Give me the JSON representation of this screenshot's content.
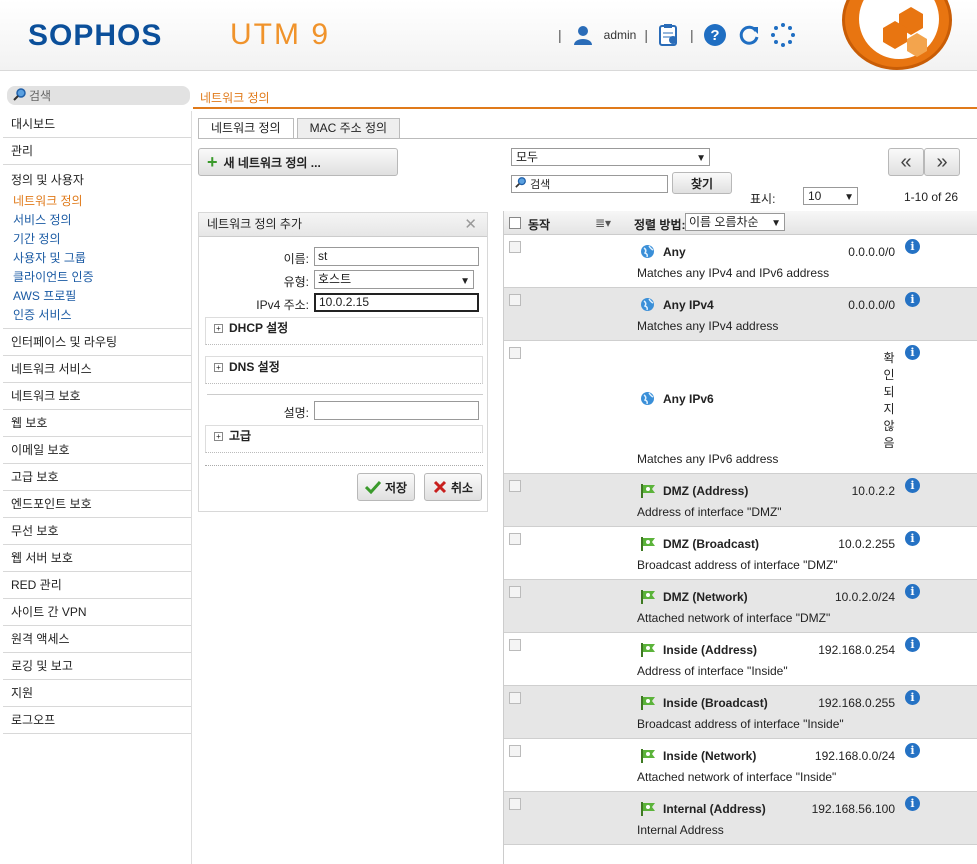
{
  "header": {
    "logo": "SOPHOS",
    "product": "UTM 9",
    "user": "admin"
  },
  "search": {
    "placeholder": "검색"
  },
  "breadcrumb": "네트워크 정의",
  "sidebar": {
    "top_items": [
      {
        "label": "대시보드"
      },
      {
        "label": "관리"
      }
    ],
    "group": {
      "title": "정의 및 사용자",
      "items": [
        {
          "label": "네트워크 정의",
          "active": true
        },
        {
          "label": "서비스 정의"
        },
        {
          "label": "기간 정의"
        },
        {
          "label": "사용자 및 그룹"
        },
        {
          "label": "클라이언트 인증"
        },
        {
          "label": "AWS 프로필"
        },
        {
          "label": "인증 서비스"
        }
      ]
    },
    "bottom_items": [
      {
        "label": "인터페이스 및 라우팅"
      },
      {
        "label": "네트워크 서비스"
      },
      {
        "label": "네트워크 보호"
      },
      {
        "label": "웹 보호"
      },
      {
        "label": "이메일 보호"
      },
      {
        "label": "고급 보호"
      },
      {
        "label": "엔드포인트 보호"
      },
      {
        "label": "무선 보호"
      },
      {
        "label": "웹 서버 보호"
      },
      {
        "label": "RED 관리"
      },
      {
        "label": "사이트 간 VPN"
      },
      {
        "label": "원격 액세스"
      },
      {
        "label": "로깅 및 보고"
      },
      {
        "label": "지원"
      },
      {
        "label": "로그오프"
      }
    ]
  },
  "tabs": [
    {
      "label": "네트워크 정의",
      "active": true
    },
    {
      "label": "MAC 주소 정의"
    }
  ],
  "toolbar": {
    "new_label": "새 네트워크 정의 ...",
    "filter_value": "모두",
    "list_search_placeholder": "검색",
    "find_label": "찾기",
    "prev_label": "«",
    "next_label": "»",
    "show_label": "표시:",
    "per_page": "10",
    "range": "1-10 of 26"
  },
  "form": {
    "title": "네트워크 정의 추가",
    "name_label": "이름:",
    "name_value": "st",
    "type_label": "유형:",
    "type_value": "호스트",
    "ipv4_label": "IPv4 주소:",
    "ipv4_value": "10.0.2.15",
    "dhcp_label": "DHCP 설정",
    "dns_label": "DNS 설정",
    "desc_label": "설명:",
    "desc_value": "",
    "advanced_label": "고급",
    "save_label": "저장",
    "cancel_label": "취소"
  },
  "list": {
    "action_header": "동작",
    "sort_label": "정렬 방법:",
    "sort_value": "이름 오름차순",
    "rows": [
      {
        "name": "Any",
        "address": "0.0.0.0/0",
        "description": "Matches any IPv4 and IPv6 address",
        "icon": "globe-icon"
      },
      {
        "name": "Any IPv4",
        "address": "0.0.0.0/0",
        "description": "Matches any IPv4 address",
        "icon": "globe-icon"
      },
      {
        "name": "Any IPv6",
        "address": "확인되지않음",
        "description": "Matches any IPv6 address",
        "icon": "globe-icon"
      },
      {
        "name": "DMZ (Address)",
        "address": "10.0.2.2",
        "description": "Address of interface \"DMZ\"",
        "icon": "interface-flag-icon"
      },
      {
        "name": "DMZ (Broadcast)",
        "address": "10.0.2.255",
        "description": "Broadcast address of interface \"DMZ\"",
        "icon": "interface-flag-icon"
      },
      {
        "name": "DMZ (Network)",
        "address": "10.0.2.0/24",
        "description": "Attached network of interface \"DMZ\"",
        "icon": "interface-flag-icon"
      },
      {
        "name": "Inside (Address)",
        "address": "192.168.0.254",
        "description": "Address of interface \"Inside\"",
        "icon": "interface-flag-icon"
      },
      {
        "name": "Inside (Broadcast)",
        "address": "192.168.0.255",
        "description": "Broadcast address of interface \"Inside\"",
        "icon": "interface-flag-icon"
      },
      {
        "name": "Inside (Network)",
        "address": "192.168.0.0/24",
        "description": "Attached network of interface \"Inside\"",
        "icon": "interface-flag-icon"
      },
      {
        "name": "Internal (Address)",
        "address": "192.168.56.100",
        "description": "Internal Address",
        "icon": "interface-flag-icon"
      }
    ]
  },
  "colors": {
    "brand_blue": "#0b4f9a",
    "accent_orange": "#e07a1a",
    "link_blue": "#1a5aa3",
    "info_blue": "#2572c4"
  }
}
